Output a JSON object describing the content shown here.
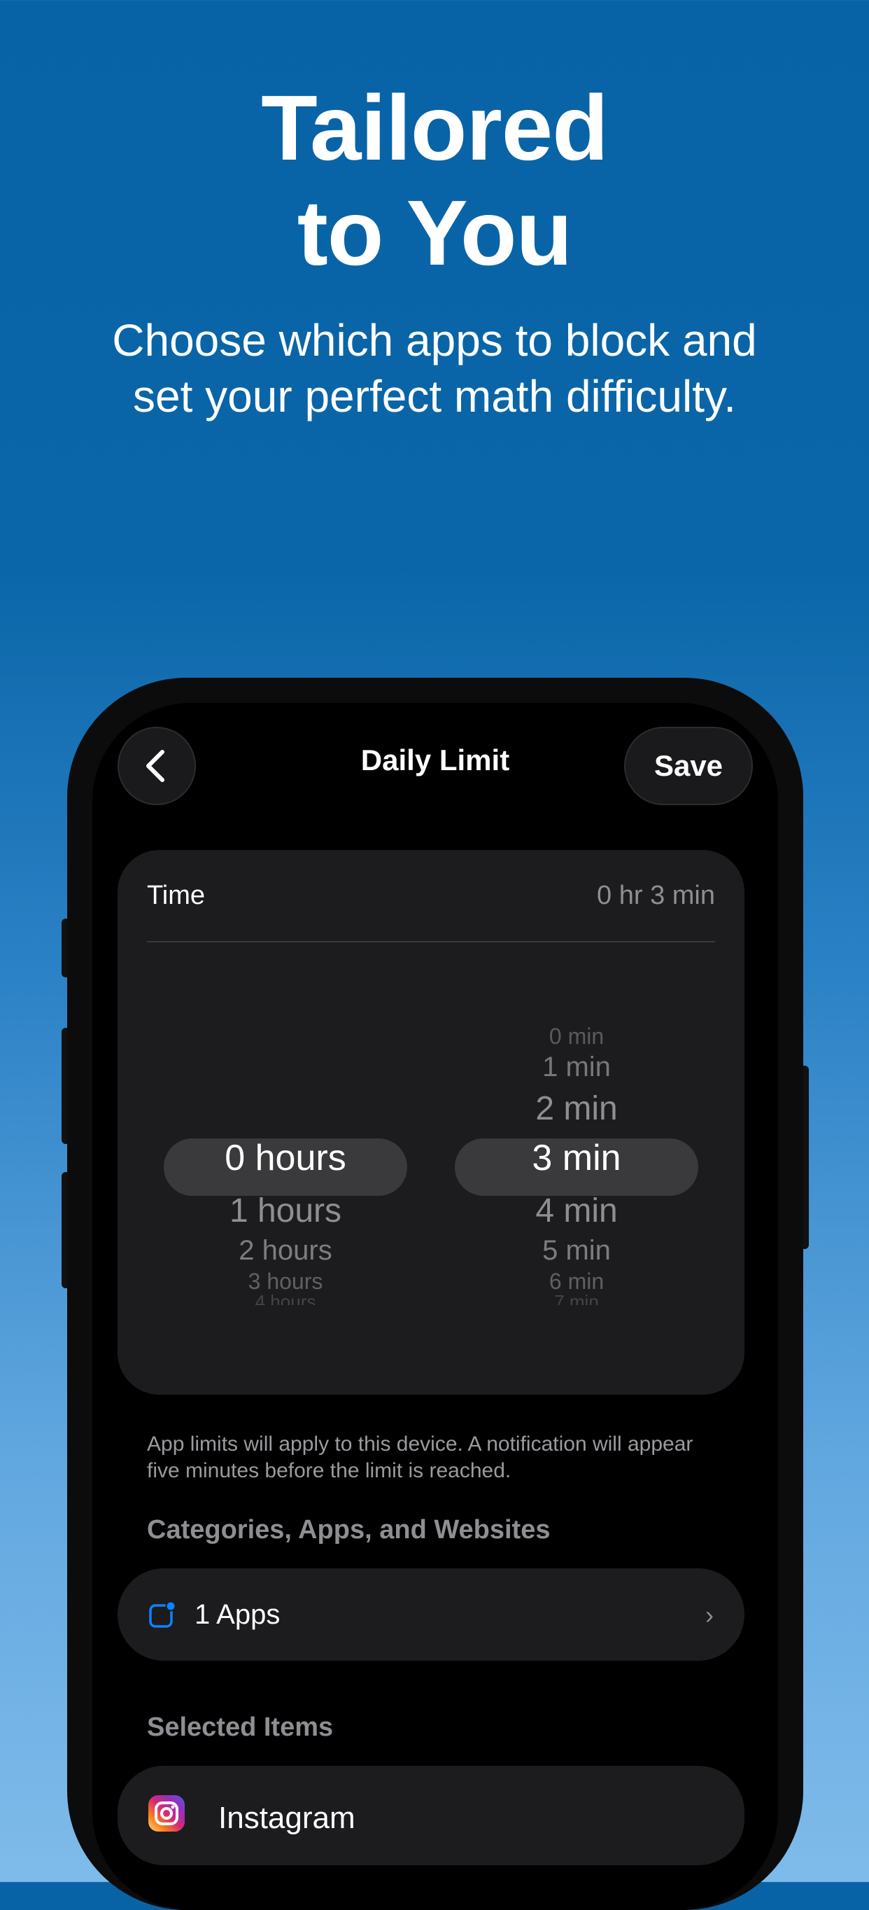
{
  "headline": {
    "line1": "Tailored",
    "line2": "to You"
  },
  "subtitle": "Choose which apps to block and set your perfect math difficulty.",
  "phone": {
    "nav": {
      "title": "Daily Limit",
      "save_label": "Save",
      "back_icon": "chevron-left-icon"
    },
    "time": {
      "label": "Time",
      "value": "0 hr 3 min",
      "hours_picker": {
        "items_above": [],
        "selected": "0 hours",
        "items_below": [
          "1 hours",
          "2 hours",
          "3 hours",
          "4 hours"
        ]
      },
      "minutes_picker": {
        "items_above": [
          "0 min",
          "1 min",
          "2 min"
        ],
        "selected": "3 min",
        "items_below": [
          "4 min",
          "5 min",
          "6 min",
          "7 min"
        ]
      }
    },
    "footnote": "App limits will apply to this device. A notification will appear five minutes before the limit is reached.",
    "categories": {
      "title": "Categories, Apps, and Websites",
      "row_label": "1 Apps",
      "row_icon": "app-square-icon",
      "chevron_icon": "chevron-right-icon"
    },
    "selected_items": {
      "title": "Selected Items",
      "items": [
        {
          "name": "Instagram",
          "icon": "instagram-icon"
        }
      ]
    }
  },
  "colors": {
    "accent": "#0a84ff",
    "background_top": "#0863a6",
    "background_bottom": "#7fbbea"
  }
}
